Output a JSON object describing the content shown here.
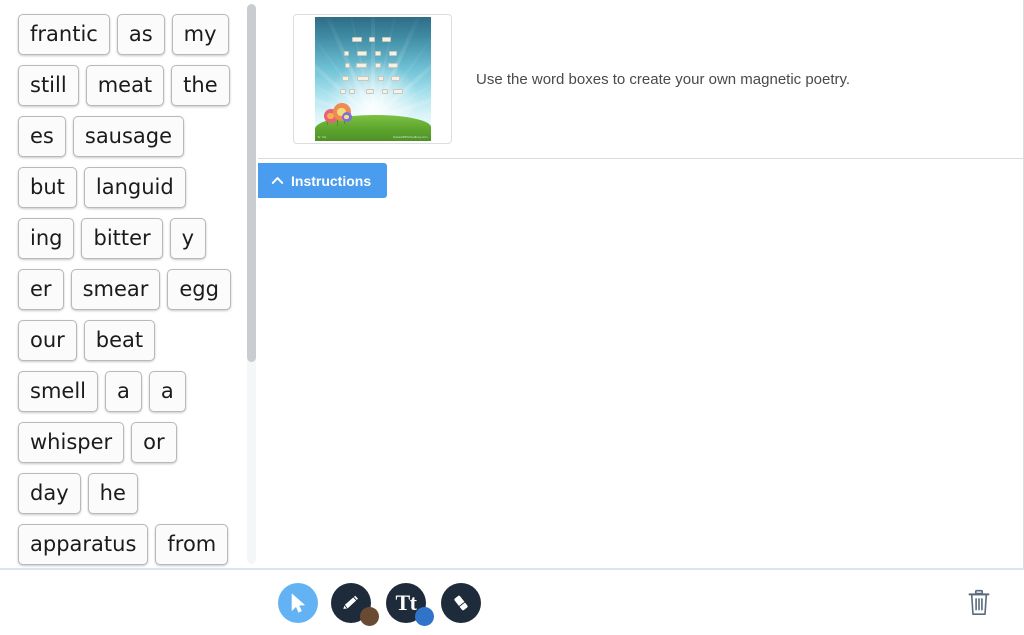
{
  "word_bank": {
    "name": "magnetic-poetry-word-bank",
    "rows": [
      [
        "frantic",
        "as",
        "my"
      ],
      [
        "still",
        "meat",
        "the"
      ],
      [
        "es",
        "sausage"
      ],
      [
        "but",
        "languid"
      ],
      [
        "ing",
        "bitter",
        "y"
      ],
      [
        "er",
        "smear",
        "egg"
      ],
      [
        "our",
        "beat"
      ],
      [
        "smell",
        "a",
        "a"
      ],
      [
        "whisper",
        "or"
      ],
      [
        "day",
        "he"
      ],
      [
        "apparatus",
        "from"
      ]
    ]
  },
  "activity": {
    "description": "Use the word boxes to create your own magnetic poetry.",
    "thumbnail_alt": "magnetic-poetry-preview",
    "thumbnail_credit_left": "Sr. Sts",
    "thumbnail_credit_right": "NaturalRPG/Sudbury.com"
  },
  "instructions": {
    "label": "Instructions",
    "icon": "chevron-up-icon",
    "expanded": false
  },
  "toolbar": {
    "tools": [
      {
        "id": "select",
        "label": "Select",
        "icon": "cursor-arrow-icon",
        "selected": true,
        "color": null
      },
      {
        "id": "pencil",
        "label": "Pencil",
        "icon": "pencil-icon",
        "selected": false,
        "color": "#6b4a34"
      },
      {
        "id": "text",
        "label": "Text",
        "icon": "text-icon",
        "glyph": "Tt",
        "selected": false,
        "color": "#2f74c8"
      },
      {
        "id": "eraser",
        "label": "Eraser",
        "icon": "eraser-icon",
        "selected": false,
        "color": null
      }
    ],
    "delete_label": "Delete",
    "delete_icon": "trash-icon"
  },
  "colors": {
    "accent_blue": "#4a9cee",
    "tool_selected": "#63b3f4",
    "tool_dark": "#1d2b3a",
    "divider": "#d6e6f7",
    "tile_bg": "#fbfbfb",
    "tile_border": "#b9b9b9",
    "pencil_swatch": "#6b4a34",
    "text_swatch": "#2f74c8",
    "trash": "#5a6b7d"
  },
  "scrollbar": {
    "name": "wordbank-scrollbar",
    "thumb_top_pct": 0,
    "thumb_height_pct": 64
  }
}
